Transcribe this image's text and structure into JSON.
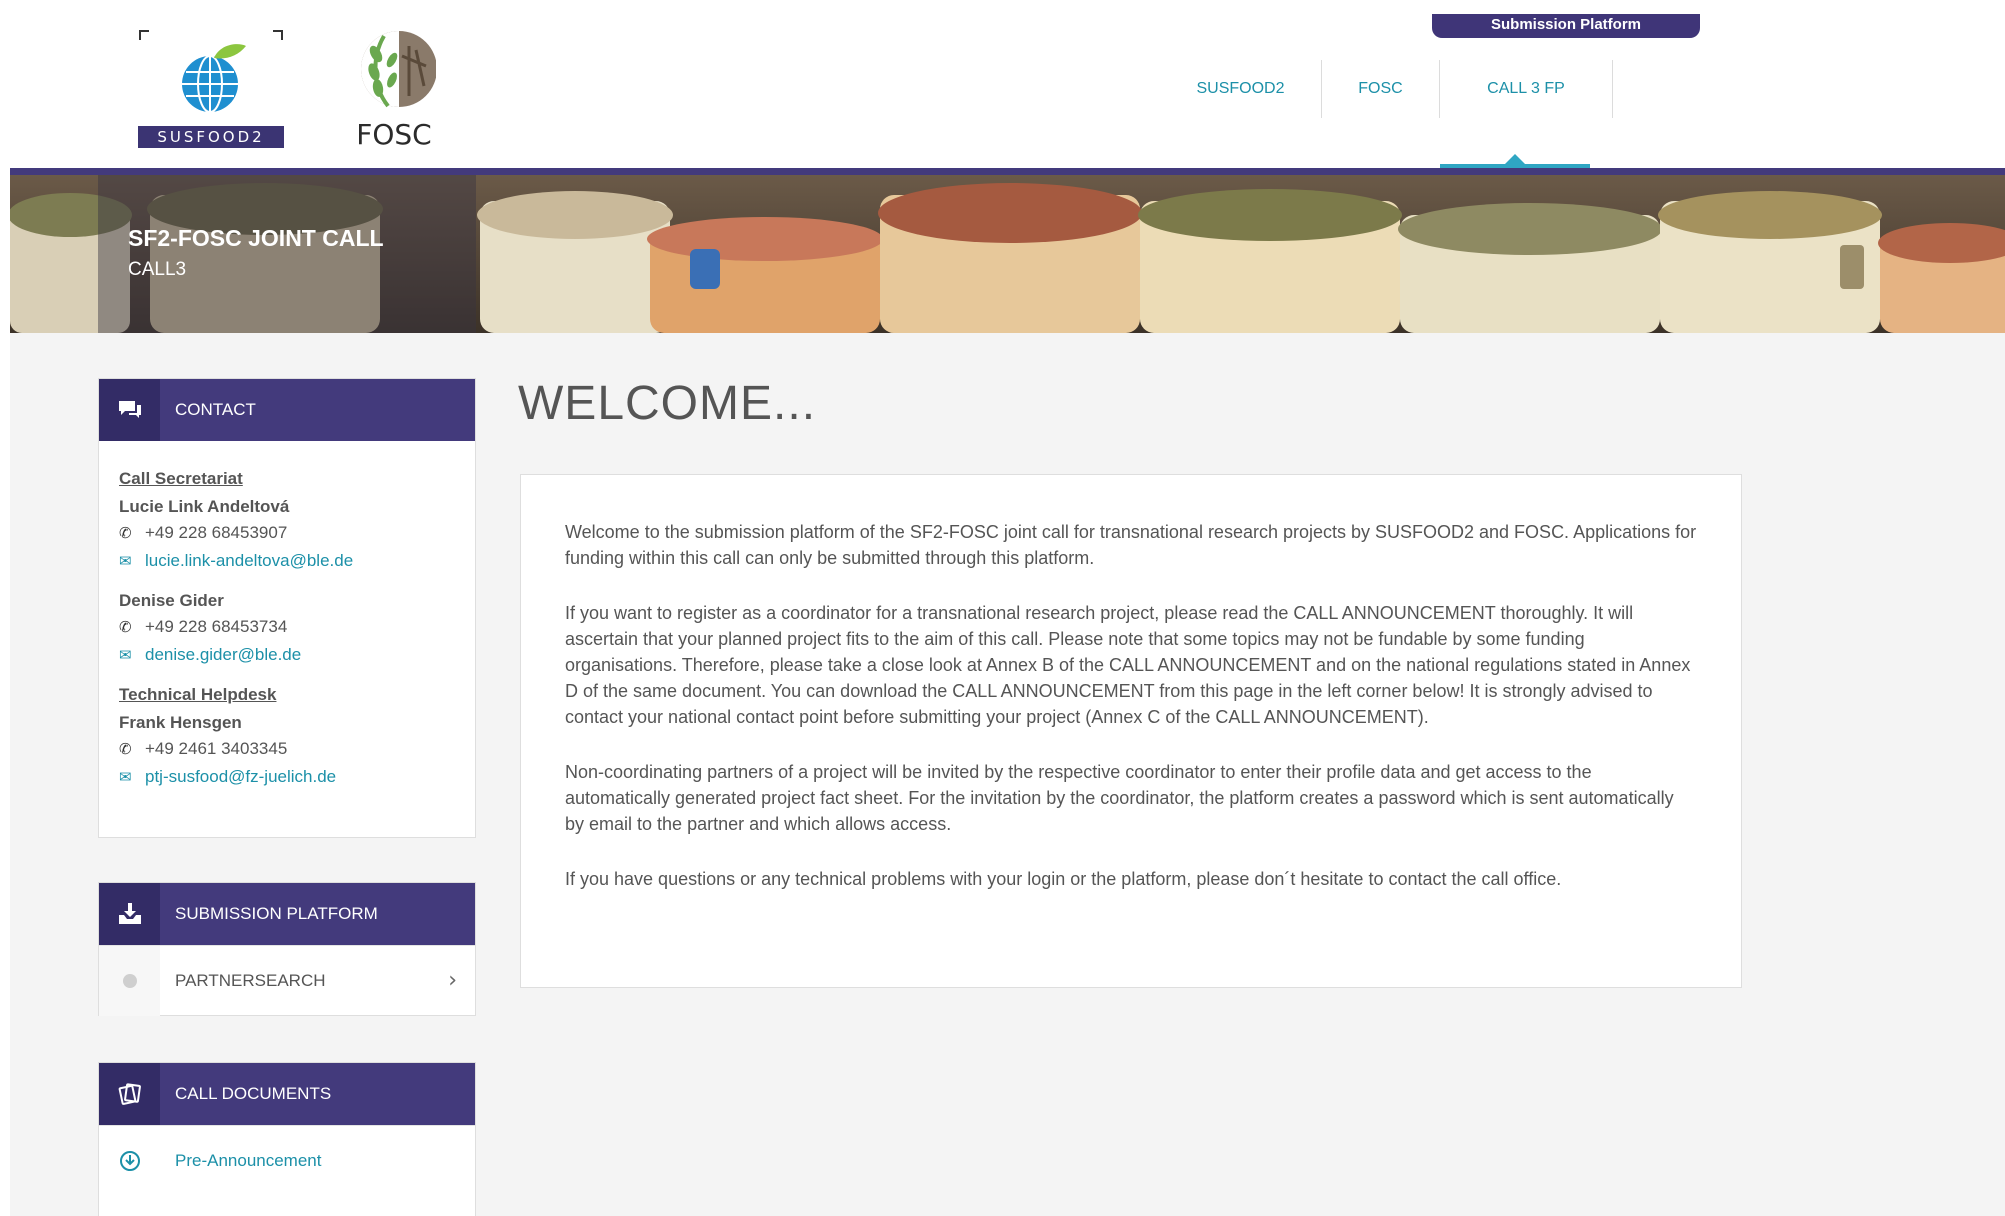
{
  "header": {
    "susfood_logo_text": "SUSFOOD2",
    "fosc_logo_text": "FOSC",
    "submission_tab": "Submission Platform",
    "nav": [
      {
        "label": "SUSFOOD2"
      },
      {
        "label": "FOSC"
      },
      {
        "label": "CALL 3 FP"
      }
    ]
  },
  "banner": {
    "title": "SF2-FOSC JOINT CALL",
    "subtitle": "CALL3"
  },
  "contact": {
    "heading": "CONTACT",
    "secretariat_heading": "Call Secretariat",
    "person1": {
      "name": "Lucie Link Andeltová",
      "phone": "+49 228 68453907",
      "email": "lucie.link-andeltova@ble.de"
    },
    "person2": {
      "name": "Denise Gider",
      "phone": "+49 228 68453734",
      "email": "denise.gider@ble.de"
    },
    "helpdesk_heading": "Technical Helpdesk",
    "person3": {
      "name": "Frank Hensgen",
      "phone": "+49 2461 3403345",
      "email": "ptj-susfood@fz-juelich.de"
    }
  },
  "submission": {
    "heading": "SUBMISSION PLATFORM",
    "items": [
      {
        "label": "PARTNERSEARCH"
      }
    ]
  },
  "documents": {
    "heading": "CALL DOCUMENTS",
    "items": [
      {
        "label": "Pre-Announcement"
      }
    ]
  },
  "welcome": {
    "title": "WELCOME...",
    "paragraphs": [
      "Welcome to the submission platform of the SF2-FOSC joint call for transnational research projects by SUSFOOD2 and FOSC. Applications for funding within this call can only be submitted through this platform.",
      "If you want to register as a coordinator for a transnational research project, please read the CALL ANNOUNCEMENT thoroughly. It will ascertain that your planned project fits to the aim of this call. Please note that some topics may not be fundable by some funding organisations. Therefore, please take a close look at Annex B of the CALL ANNOUNCEMENT and on the national regulations stated in Annex D of the same document. You can download the CALL ANNOUNCEMENT from this page in the left corner below! It is strongly advised to contact your national contact point before submitting your project (Annex C of the CALL ANNOUNCEMENT).",
      "Non-coordinating partners of a project will be invited by the respective coordinator to enter their profile data and get access to the automatically generated project fact sheet. For the invitation by the coordinator, the platform creates a password which is sent automatically by email to the partner and which allows access.",
      "If you have questions or any technical problems with your login or the platform, please don´t hesitate to contact the call office."
    ]
  },
  "colors": {
    "brand": "#433a7c",
    "link": "#1c90a8",
    "accent": "#2fa6c3"
  }
}
